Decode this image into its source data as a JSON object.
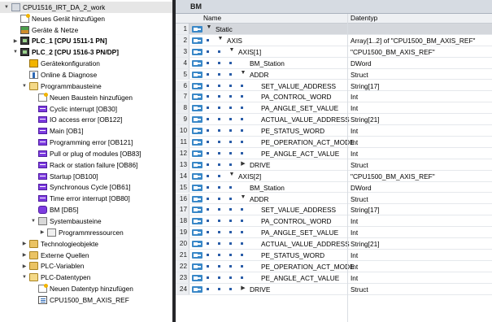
{
  "tree": [
    {
      "label": "CPU1516_IRT_DA_2_work",
      "icon": "project-icon",
      "arrow": "down",
      "indent": 0,
      "selected": true
    },
    {
      "label": "Neues Gerät hinzufügen",
      "icon": "add-device-icon",
      "arrow": "",
      "indent": 1
    },
    {
      "label": "Geräte & Netze",
      "icon": "devices-networks-icon",
      "arrow": "",
      "indent": 1
    },
    {
      "label": "PLC_1 [CPU 1511-1 PN]",
      "icon": "plc-icon",
      "arrow": "right",
      "indent": 1,
      "bold": true
    },
    {
      "label": "PLC_2 [CPU 1516-3 PN/DP]",
      "icon": "plc-icon",
      "arrow": "down",
      "indent": 1,
      "bold": true
    },
    {
      "label": "Gerätekonfiguration",
      "icon": "device-config-icon",
      "arrow": "",
      "indent": 2
    },
    {
      "label": "Online & Diagnose",
      "icon": "online-diagnostics-icon",
      "arrow": "",
      "indent": 2
    },
    {
      "label": "Programmbausteine",
      "icon": "folder-open-icon",
      "arrow": "down",
      "indent": 2
    },
    {
      "label": "Neuen Baustein hinzufügen",
      "icon": "add-block-icon",
      "arrow": "",
      "indent": 3
    },
    {
      "label": "Cyclic interrupt [OB30]",
      "icon": "ob-icon",
      "arrow": "",
      "indent": 3
    },
    {
      "label": "IO access error [OB122]",
      "icon": "ob-icon",
      "arrow": "",
      "indent": 3
    },
    {
      "label": "Main [OB1]",
      "icon": "ob-icon",
      "arrow": "",
      "indent": 3
    },
    {
      "label": "Programming error [OB121]",
      "icon": "ob-icon",
      "arrow": "",
      "indent": 3
    },
    {
      "label": "Pull or plug of modules [OB83]",
      "icon": "ob-icon",
      "arrow": "",
      "indent": 3
    },
    {
      "label": "Rack or station failure [OB86]",
      "icon": "ob-icon",
      "arrow": "",
      "indent": 3
    },
    {
      "label": "Startup [OB100]",
      "icon": "ob-icon",
      "arrow": "",
      "indent": 3
    },
    {
      "label": "Synchronous Cycle [OB61]",
      "icon": "ob-icon",
      "arrow": "",
      "indent": 3
    },
    {
      "label": "Time error interrupt [OB80]",
      "icon": "ob-icon",
      "arrow": "",
      "indent": 3
    },
    {
      "label": "BM [DB5]",
      "icon": "db-icon",
      "arrow": "",
      "indent": 3
    },
    {
      "label": "Systembausteine",
      "icon": "system-blocks-icon",
      "arrow": "down",
      "indent": 3
    },
    {
      "label": "Programmressourcen",
      "icon": "program-resources-icon",
      "arrow": "right",
      "indent": 4
    },
    {
      "label": "Technologieobjekte",
      "icon": "folder-icon",
      "arrow": "right",
      "indent": 2
    },
    {
      "label": "Externe Quellen",
      "icon": "folder-icon",
      "arrow": "right",
      "indent": 2
    },
    {
      "label": "PLC-Variablen",
      "icon": "folder-icon",
      "arrow": "right",
      "indent": 2
    },
    {
      "label": "PLC-Datentypen",
      "icon": "folder-open-icon",
      "arrow": "down",
      "indent": 2
    },
    {
      "label": "Neuen Datentyp hinzufügen",
      "icon": "add-type-icon",
      "arrow": "",
      "indent": 3
    },
    {
      "label": "CPU1500_BM_AXIS_REF",
      "icon": "datatype-icon",
      "arrow": "",
      "indent": 3
    }
  ],
  "editor": {
    "title": "BM",
    "col_name": "Name",
    "col_type": "Datentyp"
  },
  "rows": [
    {
      "n": "1",
      "name": "Static",
      "type": "",
      "depth": 0,
      "exp": "down",
      "dots": 0,
      "selected": true
    },
    {
      "n": "2",
      "name": "AXIS",
      "type": "Array[1..2] of \"CPU1500_BM_AXIS_REF\"",
      "depth": 1,
      "exp": "down",
      "dots": 1
    },
    {
      "n": "3",
      "name": "AXIS[1]",
      "type": "\"CPU1500_BM_AXIS_REF\"",
      "depth": 2,
      "exp": "down",
      "dots": 2
    },
    {
      "n": "4",
      "name": "BM_Station",
      "type": "DWord",
      "depth": 3,
      "exp": "",
      "dots": 3
    },
    {
      "n": "5",
      "name": "ADDR",
      "type": "Struct",
      "depth": 3,
      "exp": "down",
      "dots": 3
    },
    {
      "n": "6",
      "name": "SET_VALUE_ADDRESS",
      "type": "String[17]",
      "depth": 4,
      "exp": "",
      "dots": 4
    },
    {
      "n": "7",
      "name": "PA_CONTROL_WORD",
      "type": "Int",
      "depth": 4,
      "exp": "",
      "dots": 4
    },
    {
      "n": "8",
      "name": "PA_ANGLE_SET_VALUE",
      "type": "Int",
      "depth": 4,
      "exp": "",
      "dots": 4
    },
    {
      "n": "9",
      "name": "ACTUAL_VALUE_ADDRESS",
      "type": "String[21]",
      "depth": 4,
      "exp": "",
      "dots": 4
    },
    {
      "n": "10",
      "name": "PE_STATUS_WORD",
      "type": "Int",
      "depth": 4,
      "exp": "",
      "dots": 4
    },
    {
      "n": "11",
      "name": "PE_OPERATION_ACT_MODE",
      "type": "Int",
      "depth": 4,
      "exp": "",
      "dots": 4
    },
    {
      "n": "12",
      "name": "PE_ANGLE_ACT_VALUE",
      "type": "Int",
      "depth": 4,
      "exp": "",
      "dots": 4
    },
    {
      "n": "13",
      "name": "DRIVE",
      "type": "Struct",
      "depth": 3,
      "exp": "right",
      "dots": 3
    },
    {
      "n": "14",
      "name": "AXIS[2]",
      "type": "\"CPU1500_BM_AXIS_REF\"",
      "depth": 2,
      "exp": "down",
      "dots": 2
    },
    {
      "n": "15",
      "name": "BM_Station",
      "type": "DWord",
      "depth": 3,
      "exp": "",
      "dots": 3
    },
    {
      "n": "16",
      "name": "ADDR",
      "type": "Struct",
      "depth": 3,
      "exp": "down",
      "dots": 3
    },
    {
      "n": "17",
      "name": "SET_VALUE_ADDRESS",
      "type": "String[17]",
      "depth": 4,
      "exp": "",
      "dots": 4
    },
    {
      "n": "18",
      "name": "PA_CONTROL_WORD",
      "type": "Int",
      "depth": 4,
      "exp": "",
      "dots": 4
    },
    {
      "n": "19",
      "name": "PA_ANGLE_SET_VALUE",
      "type": "Int",
      "depth": 4,
      "exp": "",
      "dots": 4
    },
    {
      "n": "20",
      "name": "ACTUAL_VALUE_ADDRESS",
      "type": "String[21]",
      "depth": 4,
      "exp": "",
      "dots": 4
    },
    {
      "n": "21",
      "name": "PE_STATUS_WORD",
      "type": "Int",
      "depth": 4,
      "exp": "",
      "dots": 4
    },
    {
      "n": "22",
      "name": "PE_OPERATION_ACT_MODE",
      "type": "Int",
      "depth": 4,
      "exp": "",
      "dots": 4
    },
    {
      "n": "23",
      "name": "PE_ANGLE_ACT_VALUE",
      "type": "Int",
      "depth": 4,
      "exp": "",
      "dots": 4
    },
    {
      "n": "24",
      "name": "DRIVE",
      "type": "Struct",
      "depth": 3,
      "exp": "right",
      "dots": 3
    }
  ]
}
